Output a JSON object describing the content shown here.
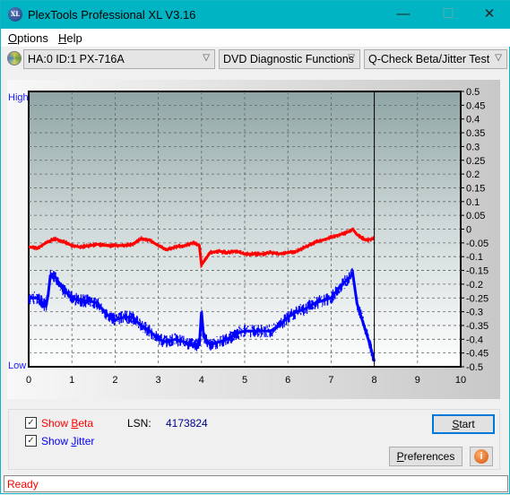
{
  "window": {
    "title": "PlexTools Professional XL V3.16",
    "app_icon_text": "XL",
    "minimize": "—",
    "maximize": "☐",
    "close": "✕"
  },
  "menu": {
    "items": [
      {
        "label": "Options",
        "accel": "O",
        "rest": "ptions"
      },
      {
        "label": "Help",
        "accel": "H",
        "rest": "elp"
      }
    ]
  },
  "toolbar": {
    "drive": "HA:0 ID:1  PX-716A",
    "function": "DVD Diagnostic Functions",
    "test": "Q-Check Beta/Jitter Test"
  },
  "chart_labels": {
    "high": "High",
    "low": "Low"
  },
  "chart_data": {
    "type": "line",
    "xlim": [
      0,
      10
    ],
    "ylim": [
      -0.5,
      0.5
    ],
    "x_ticks": [
      "0",
      "1",
      "2",
      "3",
      "4",
      "5",
      "6",
      "7",
      "8",
      "9",
      "10"
    ],
    "y_ticks": [
      "0.5",
      "0.45",
      "0.4",
      "0.35",
      "0.3",
      "0.25",
      "0.2",
      "0.15",
      "0.1",
      "0.05",
      "0",
      "-0.05",
      "-0.1",
      "-0.15",
      "-0.2",
      "-0.25",
      "-0.3",
      "-0.35",
      "-0.4",
      "-0.45",
      "-0.5"
    ],
    "grid": true,
    "position_marker_x": 8,
    "series": [
      {
        "name": "Beta",
        "color": "#ff0000",
        "x": [
          0,
          0.2,
          0.4,
          0.6,
          0.8,
          1.0,
          1.2,
          1.4,
          1.6,
          1.8,
          2.0,
          2.2,
          2.4,
          2.6,
          2.8,
          3.0,
          3.2,
          3.4,
          3.6,
          3.8,
          3.95,
          4.0,
          4.2,
          4.4,
          4.6,
          4.8,
          5.0,
          5.2,
          5.4,
          5.6,
          5.8,
          6.0,
          6.2,
          6.4,
          6.6,
          6.8,
          7.0,
          7.2,
          7.4,
          7.5,
          7.6,
          7.8,
          8.0
        ],
        "y": [
          -0.065,
          -0.07,
          -0.05,
          -0.035,
          -0.045,
          -0.06,
          -0.065,
          -0.06,
          -0.055,
          -0.06,
          -0.06,
          -0.06,
          -0.055,
          -0.035,
          -0.04,
          -0.06,
          -0.075,
          -0.065,
          -0.06,
          -0.05,
          -0.06,
          -0.13,
          -0.085,
          -0.08,
          -0.085,
          -0.08,
          -0.09,
          -0.09,
          -0.09,
          -0.085,
          -0.09,
          -0.085,
          -0.08,
          -0.065,
          -0.05,
          -0.04,
          -0.03,
          -0.02,
          -0.01,
          0,
          -0.02,
          -0.04,
          -0.035
        ]
      },
      {
        "name": "Jitter",
        "color": "#0000ff",
        "x": [
          0,
          0.2,
          0.4,
          0.45,
          0.5,
          0.6,
          0.8,
          1.0,
          1.2,
          1.4,
          1.6,
          1.8,
          2.0,
          2.2,
          2.4,
          2.6,
          2.8,
          3.0,
          3.2,
          3.4,
          3.6,
          3.8,
          3.95,
          4.0,
          4.05,
          4.2,
          4.4,
          4.6,
          4.8,
          5.0,
          5.2,
          5.4,
          5.6,
          5.8,
          6.0,
          6.2,
          6.4,
          6.6,
          6.8,
          7.0,
          7.2,
          7.4,
          7.5,
          7.6,
          7.8,
          7.9,
          8.0
        ],
        "y": [
          -0.25,
          -0.25,
          -0.28,
          -0.24,
          -0.17,
          -0.17,
          -0.22,
          -0.25,
          -0.26,
          -0.26,
          -0.27,
          -0.31,
          -0.33,
          -0.32,
          -0.32,
          -0.35,
          -0.37,
          -0.4,
          -0.41,
          -0.4,
          -0.41,
          -0.42,
          -0.42,
          -0.3,
          -0.39,
          -0.42,
          -0.41,
          -0.4,
          -0.38,
          -0.37,
          -0.37,
          -0.37,
          -0.37,
          -0.35,
          -0.32,
          -0.3,
          -0.29,
          -0.27,
          -0.26,
          -0.25,
          -0.21,
          -0.18,
          -0.16,
          -0.27,
          -0.37,
          -0.42,
          -0.48
        ]
      }
    ]
  },
  "controls": {
    "show_beta": {
      "label": "Show Beta",
      "accel": "B",
      "pre": "Show ",
      "post": "eta",
      "checked": true
    },
    "show_jitter": {
      "label": "Show Jitter",
      "accel": "J",
      "pre": "Show ",
      "post": "itter",
      "checked": true
    },
    "lsn_label": "LSN:",
    "lsn_value": "4173824",
    "start": {
      "accel": "S",
      "rest": "tart"
    },
    "preferences": {
      "accel": "P",
      "rest": "references"
    },
    "info": "i",
    "check": "✓"
  },
  "status": "Ready"
}
